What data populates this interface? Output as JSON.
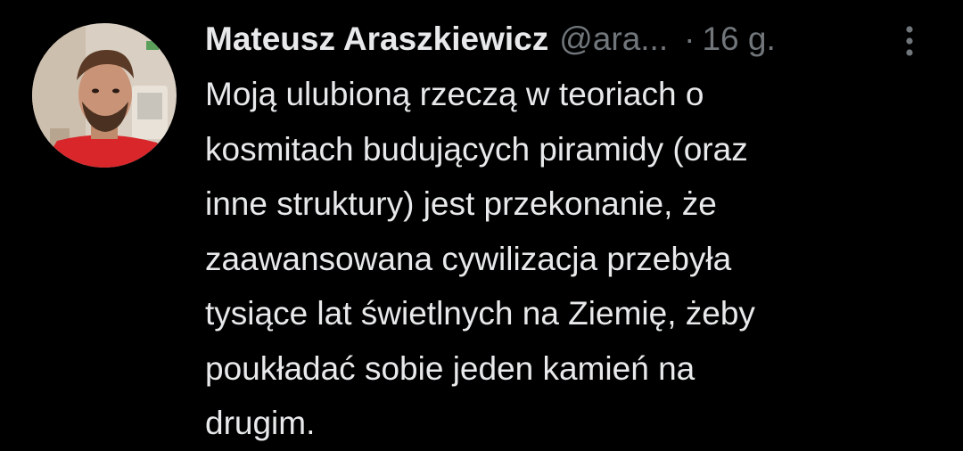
{
  "tweet": {
    "author_name": "Mateusz Araszkiewicz",
    "handle": "@ara...",
    "separator": "·",
    "time": "16 g.",
    "text": "Moją ulubioną rzeczą w teoriach o\nkosmitach budujących piramidy (oraz\ninne struktury) jest przekonanie, że\nzaawansowana cywilizacja przebyła\ntysiące lat świetlnych na Ziemię, żeby\npoukładać sobie jeden kamień na\ndrugim."
  },
  "icons": {
    "more": "more-options-icon",
    "avatar": "avatar"
  },
  "colors": {
    "background": "#000000",
    "primary_text": "#e7e9ea",
    "secondary_text": "#71767b",
    "avatar_shirt": "#d8262a"
  }
}
